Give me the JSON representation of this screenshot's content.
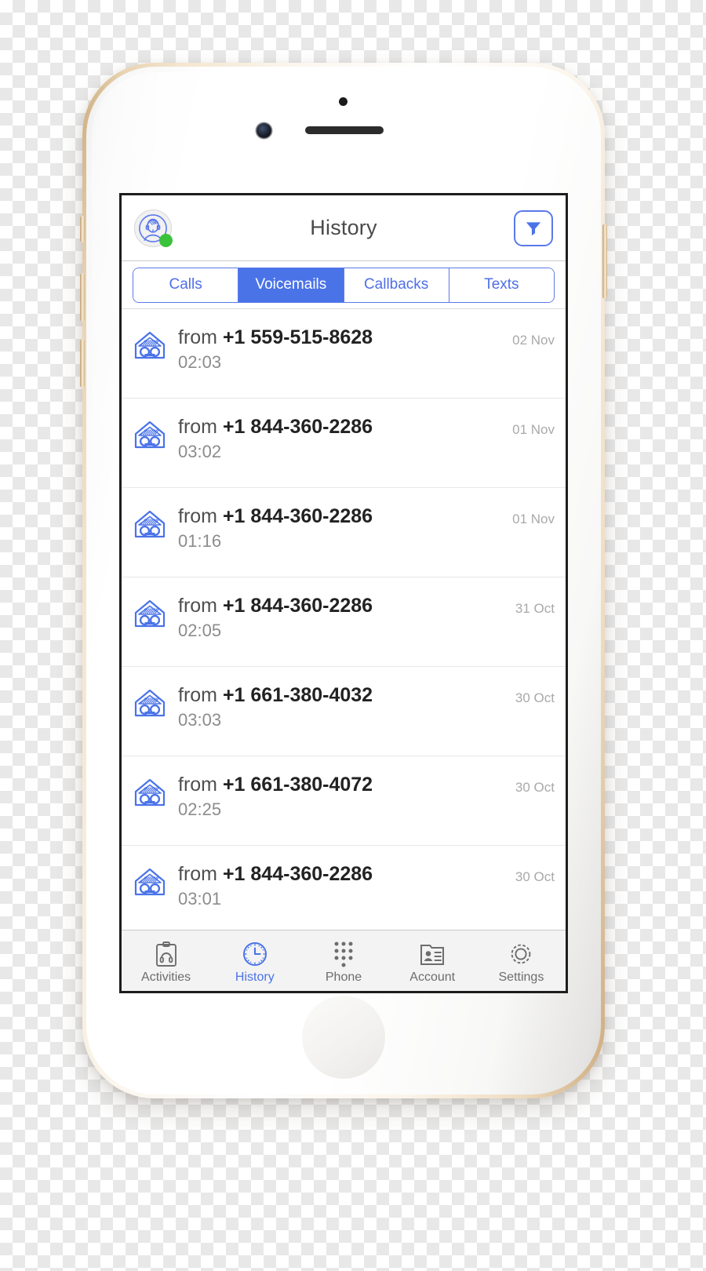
{
  "device": {
    "name": "iphone-gold-white",
    "hardware": {
      "earpiece": "earpiece-speaker",
      "front_camera": "front-camera",
      "sensor": "proximity-sensor",
      "home_button": "home-button",
      "silent_switch": "silent-switch",
      "volume_up": "volume-up-button",
      "volume_down": "volume-down-button",
      "power": "power-button"
    }
  },
  "colors": {
    "accent": "#4a73e8",
    "accent_light": "#5b79ea",
    "online": "#3bc23b",
    "text_primary": "#222222",
    "text_secondary": "#8c8c8c",
    "text_muted": "#a9a9a9",
    "tabbar_bg": "#f3f3f3",
    "divider": "#e7e7e7"
  },
  "navbar": {
    "title": "History",
    "avatar_icon": "agent-headset-avatar-icon",
    "status_indicator": "online-status-dot",
    "filter_icon": "filter-funnel-icon"
  },
  "segmented": {
    "selected": "Voicemails",
    "items": [
      {
        "label": "Calls",
        "active": false
      },
      {
        "label": "Voicemails",
        "active": true
      },
      {
        "label": "Callbacks",
        "active": false
      },
      {
        "label": "Texts",
        "active": false
      }
    ]
  },
  "list": {
    "item_icon": "voicemail-envelope-icon",
    "from_label": "from",
    "rows": [
      {
        "from": "from",
        "number": "+1 559-515-8628",
        "duration": "02:03",
        "date": "02 Nov"
      },
      {
        "from": "from",
        "number": "+1 844-360-2286",
        "duration": "03:02",
        "date": "01 Nov"
      },
      {
        "from": "from",
        "number": "+1 844-360-2286",
        "duration": "01:16",
        "date": "01 Nov"
      },
      {
        "from": "from",
        "number": "+1 844-360-2286",
        "duration": "02:05",
        "date": "31 Oct"
      },
      {
        "from": "from",
        "number": "+1 661-380-4032",
        "duration": "03:03",
        "date": "30 Oct"
      },
      {
        "from": "from",
        "number": "+1 661-380-4072",
        "duration": "02:25",
        "date": "30 Oct"
      },
      {
        "from": "from",
        "number": "+1 844-360-2286",
        "duration": "03:01",
        "date": "30 Oct"
      }
    ]
  },
  "tabbar": {
    "active": "History",
    "items": [
      {
        "label": "Activities",
        "icon": "clipboard-headset-icon",
        "active": false
      },
      {
        "label": "History",
        "icon": "clock-icon",
        "active": true
      },
      {
        "label": "Phone",
        "icon": "dialpad-icon",
        "active": false
      },
      {
        "label": "Account",
        "icon": "contact-card-icon",
        "active": false
      },
      {
        "label": "Settings",
        "icon": "gear-icon",
        "active": false
      }
    ]
  }
}
